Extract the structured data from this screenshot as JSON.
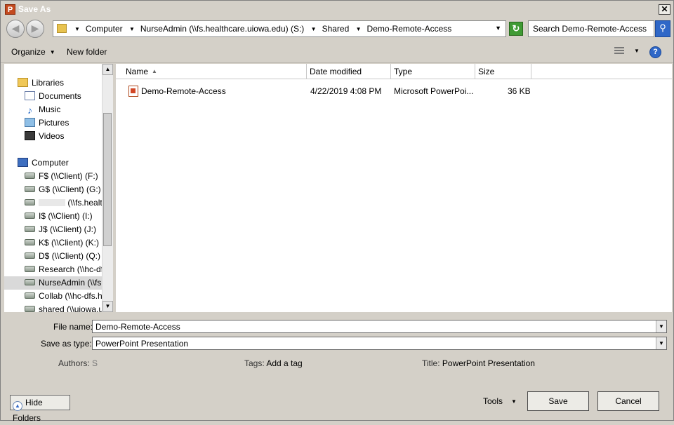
{
  "window": {
    "title": "Save As",
    "app_icon_letter": "P",
    "close_glyph": "✕"
  },
  "nav": {
    "back_glyph": "◀",
    "forward_glyph": "▶",
    "breadcrumb": [
      "Computer",
      "NurseAdmin (\\\\fs.healthcare.uiowa.edu) (S:)",
      "Shared",
      "Demo-Remote-Access"
    ],
    "refresh_glyph": "↻",
    "search_placeholder": "Search Demo-Remote-Access",
    "search_glyph": "⚲"
  },
  "toolbar": {
    "organize_label": "Organize",
    "new_folder_label": "New folder",
    "help_glyph": "?"
  },
  "sidebar": {
    "items": [
      {
        "label": "Libraries",
        "icon": "libraries-icon",
        "kind": "lib",
        "indent": 0
      },
      {
        "label": "Documents",
        "icon": "documents-icon",
        "kind": "doc",
        "indent": 1
      },
      {
        "label": "Music",
        "icon": "music-icon",
        "kind": "music",
        "indent": 1
      },
      {
        "label": "Pictures",
        "icon": "pictures-icon",
        "kind": "pic",
        "indent": 1
      },
      {
        "label": "Videos",
        "icon": "videos-icon",
        "kind": "vid",
        "indent": 1
      },
      {
        "label": "Computer",
        "icon": "computer-icon",
        "kind": "comp",
        "indent": 0
      },
      {
        "label": "F$ (\\\\Client) (F:)",
        "icon": "network-drive-icon",
        "kind": "drive",
        "indent": 1
      },
      {
        "label": "G$ (\\\\Client) (G:)",
        "icon": "network-drive-icon",
        "kind": "drive",
        "indent": 1
      },
      {
        "label": "(\\\\fs.healt",
        "icon": "network-drive-icon",
        "kind": "drive",
        "indent": 1,
        "redacted_prefix": true
      },
      {
        "label": "I$ (\\\\Client) (I:)",
        "icon": "network-drive-icon",
        "kind": "drive",
        "indent": 1
      },
      {
        "label": "J$ (\\\\Client) (J:)",
        "icon": "network-drive-icon",
        "kind": "drive",
        "indent": 1
      },
      {
        "label": "K$ (\\\\Client) (K:)",
        "icon": "network-drive-icon",
        "kind": "drive",
        "indent": 1
      },
      {
        "label": "D$ (\\\\Client) (Q:)",
        "icon": "network-drive-icon",
        "kind": "drive",
        "indent": 1
      },
      {
        "label": "Research (\\\\hc-dfs",
        "icon": "network-drive-icon",
        "kind": "drive",
        "indent": 1
      },
      {
        "label": "NurseAdmin (\\\\fs.h",
        "icon": "network-drive-icon",
        "kind": "drive",
        "indent": 1,
        "selected": true
      },
      {
        "label": "Collab (\\\\hc-dfs.he",
        "icon": "network-drive-icon",
        "kind": "drive",
        "indent": 1
      },
      {
        "label": "shared (\\\\uiowa.uio",
        "icon": "network-drive-icon",
        "kind": "drive",
        "indent": 1
      }
    ]
  },
  "files": {
    "columns": [
      "Name",
      "Date modified",
      "Type",
      "Size"
    ],
    "rows": [
      {
        "name": "Demo-Remote-Access",
        "date": "4/22/2019 4:08 PM",
        "type": "Microsoft PowerPoi...",
        "size": "36 KB"
      }
    ]
  },
  "form": {
    "file_name_label": "File name:",
    "file_name_value": "Demo-Remote-Access",
    "save_type_label": "Save as type:",
    "save_type_value": "PowerPoint Presentation",
    "authors_label": "Authors:",
    "authors_value": "S",
    "tags_label": "Tags:",
    "tags_value": "Add a tag",
    "title_label": "Title:",
    "title_value": "PowerPoint Presentation"
  },
  "footer": {
    "hide_folders_label": "Hide Folders",
    "tools_label": "Tools",
    "save_label": "Save",
    "cancel_label": "Cancel"
  }
}
